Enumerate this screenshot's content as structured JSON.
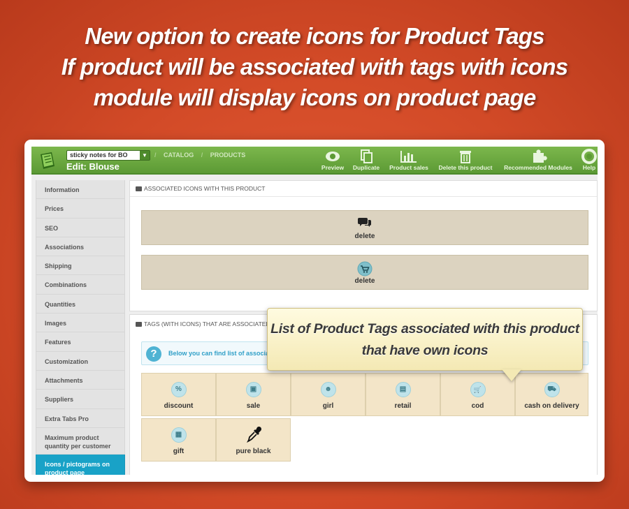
{
  "headline": {
    "line1": "New option to create icons for Product Tags",
    "line2": "If product will be associated with tags with icons",
    "line3": "module will display icons on product page"
  },
  "topbar": {
    "shop_select": "sticky notes for BO",
    "breadcrumb": [
      "CATALOG",
      "PRODUCTS"
    ],
    "page_title": "Edit: Blouse",
    "buttons": [
      {
        "label": "Preview",
        "icon": "eye-icon"
      },
      {
        "label": "Duplicate",
        "icon": "copy-icon"
      },
      {
        "label": "Product sales",
        "icon": "bar-chart-icon"
      },
      {
        "label": "Delete this product",
        "icon": "trash-icon"
      },
      {
        "label": "Recommended Modules",
        "icon": "puzzle-icon"
      },
      {
        "label": "Help",
        "icon": "lifebuoy-icon"
      }
    ]
  },
  "sidebar": {
    "items": [
      "Information",
      "Prices",
      "SEO",
      "Associations",
      "Shipping",
      "Combinations",
      "Quantities",
      "Images",
      "Features",
      "Customization",
      "Attachments",
      "Suppliers",
      "Extra Tabs Pro",
      "Maximum product quantity per customer",
      "Icons / pictograms on product page"
    ],
    "active_index": 14
  },
  "associated_icons": {
    "heading": "ASSOCIATED ICONS WITH THIS PRODUCT",
    "items": [
      {
        "icon": "comments-icon",
        "action": "delete"
      },
      {
        "icon": "cart-icon",
        "action": "delete"
      }
    ]
  },
  "tags_panel": {
    "heading": "TAGS (WITH ICONS) THAT ARE ASSOCIATED WIT",
    "info": "Below you can find list of associat",
    "tags": [
      {
        "label": "discount",
        "icon": "percent-icon",
        "glyph": "%"
      },
      {
        "label": "sale",
        "icon": "bag-icon",
        "glyph": "▣"
      },
      {
        "label": "girl",
        "icon": "girl-icon",
        "glyph": "☻"
      },
      {
        "label": "retail",
        "icon": "register-icon",
        "glyph": "▤"
      },
      {
        "label": "cod",
        "icon": "cart-icon",
        "glyph": "🛒"
      },
      {
        "label": "cash on delivery",
        "icon": "truck-icon",
        "glyph": "⛟"
      },
      {
        "label": "gift",
        "icon": "gift-card-icon",
        "glyph": "▦"
      },
      {
        "label": "pure black",
        "icon": "eyedropper-icon",
        "glyph": ""
      }
    ]
  },
  "callout": {
    "line1": "List of Product Tags associated with this product",
    "line2": "that have own icons"
  },
  "colors": {
    "background": "#d24a27",
    "topbar": "#6aa83f",
    "active_tab": "#19a2c7",
    "tag_bg": "#f3e5c8",
    "callout_bg": "#fbf3cc"
  }
}
